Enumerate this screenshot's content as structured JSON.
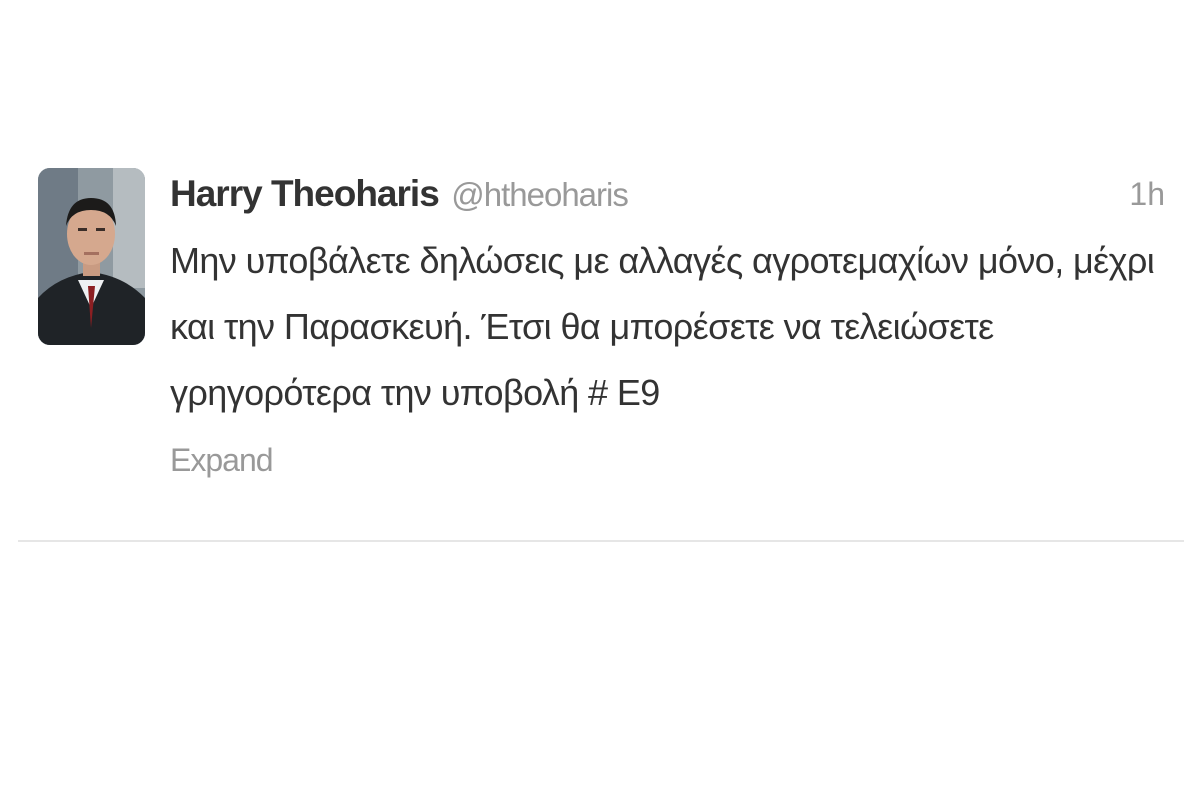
{
  "tweet": {
    "fullname": "Harry Theoharis",
    "username": "@htheoharis",
    "time": "1h",
    "text": "Μην υποβάλετε δηλώσεις με αλλαγές αγροτεμαχίων μόνο, μέχρι και την Παρασκευή. Έτσι θα μπορέσετε να τελειώσετε γρηγορότερα την υποβολή # Ε9",
    "expand_label": "Expand",
    "avatar_icon": "user-avatar-photo"
  },
  "colors": {
    "text": "#333333",
    "muted": "#999999",
    "divider": "#e6e6e6",
    "background": "#ffffff"
  }
}
